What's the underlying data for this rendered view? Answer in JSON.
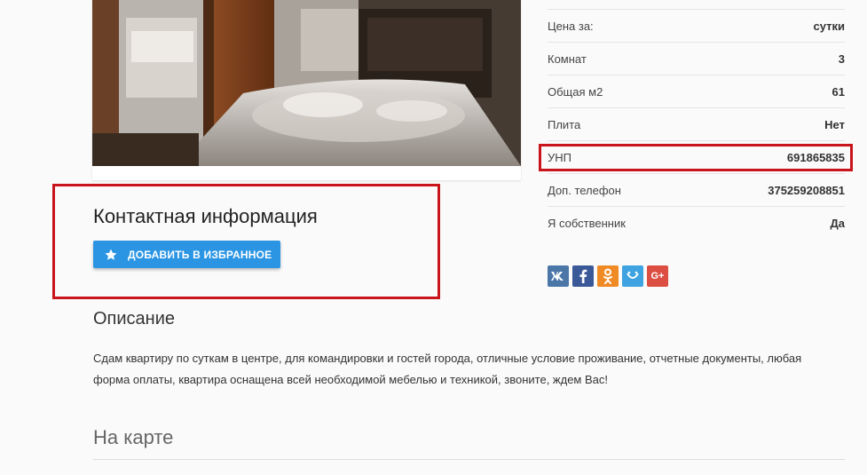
{
  "contact": {
    "title": "Контактная информация",
    "favorite_label": "ДОБАВИТЬ В ИЗБРАННОЕ",
    "favorite_icon": "star-icon"
  },
  "description": {
    "title": "Описание",
    "text": "Сдам квартиру по суткам в центре, для командировки и гостей города, отличные условие проживание, отчетные документы, любая форма оплаты, квартира оснащена всей необходимой мебелью и техникой, звоните, ждем Вас!"
  },
  "map": {
    "title": "На карте"
  },
  "properties": [
    {
      "key": "Цена за:",
      "value": "сутки"
    },
    {
      "key": "Комнат",
      "value": "3"
    },
    {
      "key": "Общая м2",
      "value": "61"
    },
    {
      "key": "Плита",
      "value": "Нет"
    },
    {
      "key": "УНП",
      "value": "691865835"
    },
    {
      "key": "Доп. телефон",
      "value": "375259208851"
    },
    {
      "key": "Я собственник",
      "value": "Да"
    }
  ],
  "social": [
    {
      "name": "vk-icon",
      "glyph": "vk",
      "color": "#4a76a8"
    },
    {
      "name": "facebook-icon",
      "glyph": "f",
      "color": "#3b5998"
    },
    {
      "name": "odnoklassniki-icon",
      "glyph": "ok",
      "color": "#f08a24"
    },
    {
      "name": "moimir-icon",
      "glyph": "mm",
      "color": "#3ea3e0"
    },
    {
      "name": "google-plus-icon",
      "glyph": "G+",
      "color": "#dc4e41"
    }
  ],
  "colors": {
    "accent": "#2b95e4",
    "highlight": "#c9141b"
  }
}
